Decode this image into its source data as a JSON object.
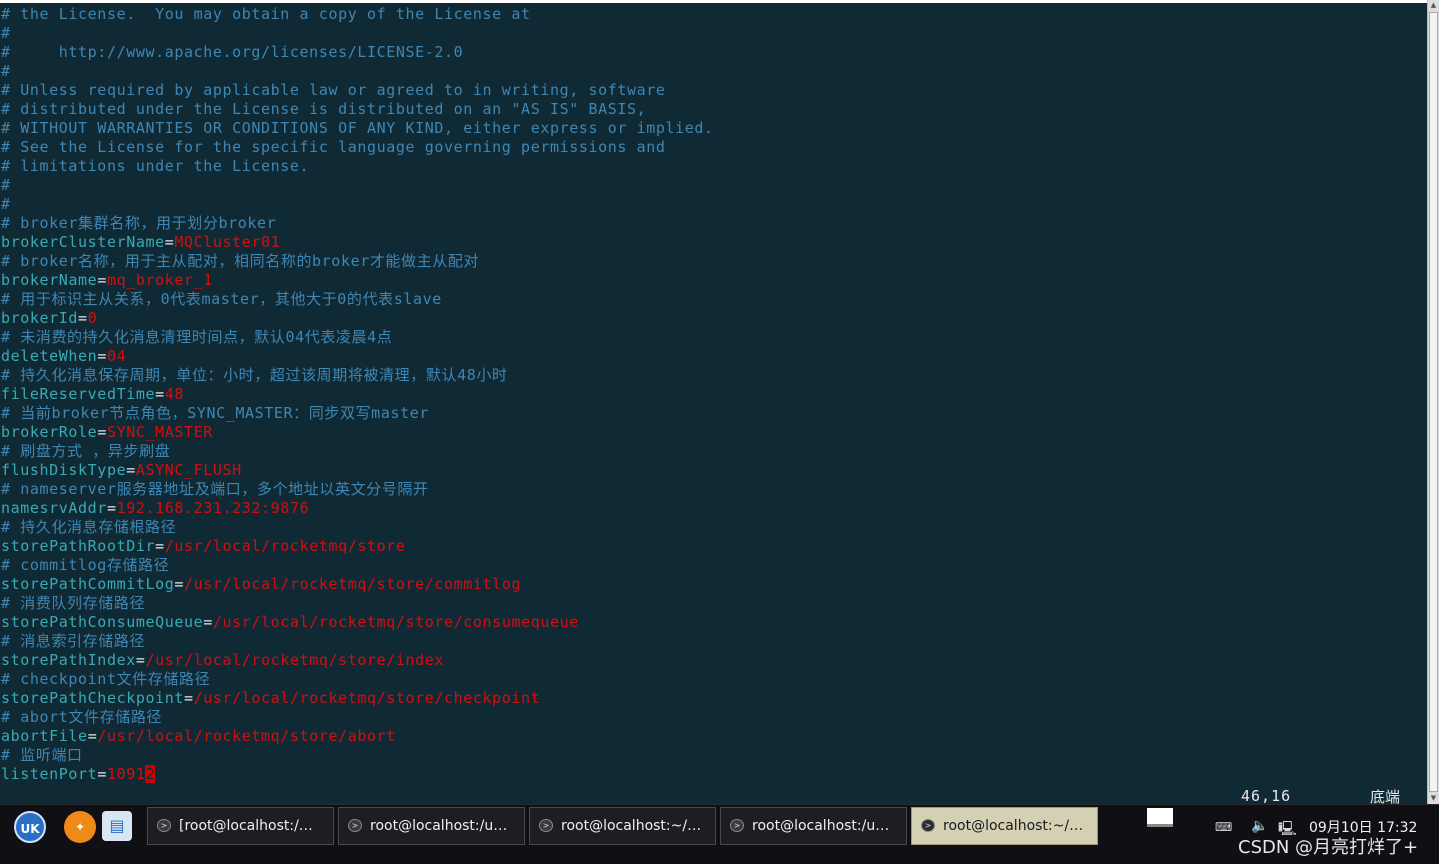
{
  "editor": {
    "lines": [
      {
        "type": "comment",
        "text": "# the License.  You may obtain a copy of the License at"
      },
      {
        "type": "comment",
        "text": "#"
      },
      {
        "type": "comment",
        "text": "#     http://www.apache.org/licenses/LICENSE-2.0"
      },
      {
        "type": "comment",
        "text": "#"
      },
      {
        "type": "comment",
        "text": "# Unless required by applicable law or agreed to in writing, software"
      },
      {
        "type": "comment",
        "text": "# distributed under the License is distributed on an \"AS IS\" BASIS,"
      },
      {
        "type": "comment",
        "text": "# WITHOUT WARRANTIES OR CONDITIONS OF ANY KIND, either express or implied."
      },
      {
        "type": "comment",
        "text": "# See the License for the specific language governing permissions and"
      },
      {
        "type": "comment",
        "text": "# limitations under the License."
      },
      {
        "type": "comment",
        "text": "#"
      },
      {
        "type": "comment",
        "text": "#"
      },
      {
        "type": "comment",
        "text": "# broker集群名称，用于划分broker"
      },
      {
        "type": "kv",
        "key": "brokerClusterName",
        "value": "MQCluster01"
      },
      {
        "type": "comment",
        "text": "# broker名称，用于主从配对，相同名称的broker才能做主从配对"
      },
      {
        "type": "kv",
        "key": "brokerName",
        "value": "mq_broker_1"
      },
      {
        "type": "comment",
        "text": "# 用于标识主从关系，0代表master，其他大于0的代表slave"
      },
      {
        "type": "kv",
        "key": "brokerId",
        "value": "0"
      },
      {
        "type": "comment",
        "text": "# 未消费的持久化消息清理时间点，默认04代表凌晨4点"
      },
      {
        "type": "kv",
        "key": "deleteWhen",
        "value": "04"
      },
      {
        "type": "comment",
        "text": "# 持久化消息保存周期，单位：小时，超过该周期将被清理，默认48小时"
      },
      {
        "type": "kv",
        "key": "fileReservedTime",
        "value": "48"
      },
      {
        "type": "comment",
        "text": "# 当前broker节点角色，SYNC_MASTER：同步双写master"
      },
      {
        "type": "kv",
        "key": "brokerRole",
        "value": "SYNC_MASTER"
      },
      {
        "type": "comment",
        "text": "# 刷盘方式 ，异步刷盘"
      },
      {
        "type": "kv",
        "key": "flushDiskType",
        "value": "ASYNC_FLUSH"
      },
      {
        "type": "comment",
        "text": "# nameserver服务器地址及端口，多个地址以英文分号隔开"
      },
      {
        "type": "kv",
        "key": "namesrvAddr",
        "value": "192.168.231.232:9876"
      },
      {
        "type": "comment",
        "text": "# 持久化消息存储根路径"
      },
      {
        "type": "kv",
        "key": "storePathRootDir",
        "value": "/usr/local/rocketmq/store"
      },
      {
        "type": "comment",
        "text": "# commitlog存储路径"
      },
      {
        "type": "kv",
        "key": "storePathCommitLog",
        "value": "/usr/local/rocketmq/store/commitlog"
      },
      {
        "type": "comment",
        "text": "# 消费队列存储路径"
      },
      {
        "type": "kv",
        "key": "storePathConsumeQueue",
        "value": "/usr/local/rocketmq/store/consumequeue"
      },
      {
        "type": "comment",
        "text": "# 消息索引存储路径"
      },
      {
        "type": "kv",
        "key": "storePathIndex",
        "value": "/usr/local/rocketmq/store/index"
      },
      {
        "type": "comment",
        "text": "# checkpoint文件存储路径"
      },
      {
        "type": "kv",
        "key": "storePathCheckpoint",
        "value": "/usr/local/rocketmq/store/checkpoint"
      },
      {
        "type": "comment",
        "text": "# abort文件存储路径"
      },
      {
        "type": "kv",
        "key": "abortFile",
        "value": "/usr/local/rocketmq/store/abort"
      },
      {
        "type": "comment",
        "text": "# 监听端口"
      },
      {
        "type": "kv",
        "key": "listenPort",
        "value": "1091",
        "cursor_char": "2"
      }
    ],
    "status": {
      "position": "46,16",
      "scroll": "底端"
    }
  },
  "taskbar": {
    "launchers": {
      "menu_glyph": "UK",
      "firefox_glyph": "✦",
      "files_glyph": "▤"
    },
    "tasks": [
      {
        "label": "[root@localhost:/…",
        "active": false
      },
      {
        "label": "root@localhost:/u…",
        "active": false
      },
      {
        "label": "root@localhost:~/…",
        "active": false
      },
      {
        "label": "root@localhost:/u…",
        "active": false
      },
      {
        "label": "root@localhost:~/…",
        "active": true
      }
    ],
    "tray": {
      "keyboard_glyph": "⌨",
      "volume_glyph": "🔈",
      "network_glyph": "🖳"
    },
    "clock": "09月10日 17:32",
    "watermark": "CSDN @月亮打烊了+"
  },
  "colors": {
    "terminal_bg": "#102a35",
    "comment": "#3f86b3",
    "key": "#39aab3",
    "value": "#d20f0f",
    "cursor": "#d00000",
    "taskbar_bg": "#0f0f14",
    "active_task": "#d4d0b4"
  }
}
